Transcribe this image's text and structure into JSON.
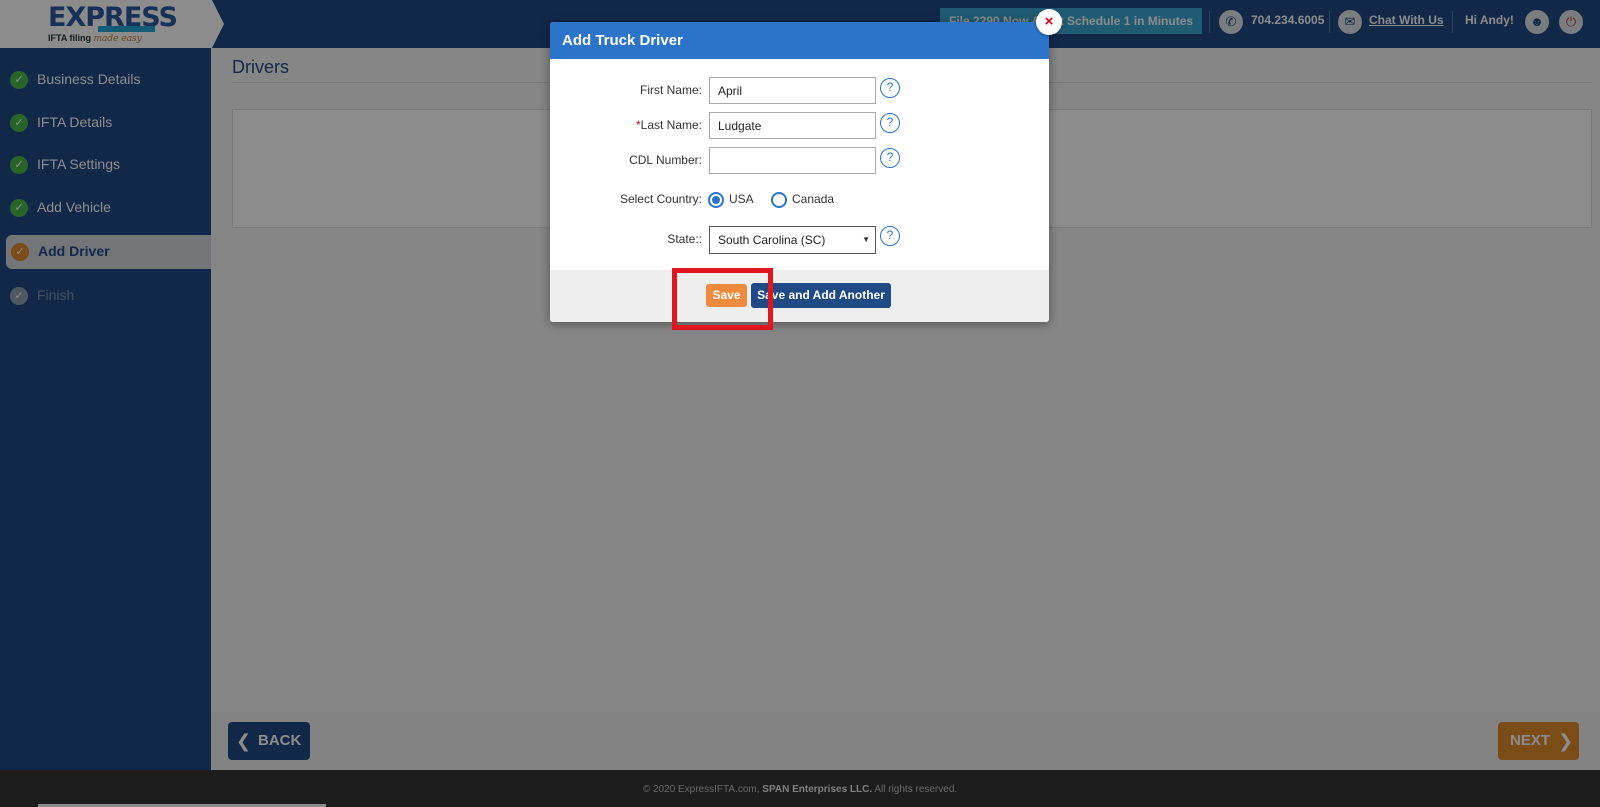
{
  "header": {
    "logo_text": "EXPRESS",
    "logo_badge": "IFTA",
    "logo_tagline": "IFTA filing",
    "logo_tagline_script": "made easy",
    "promo_text": "File 2290 Now & Get Schedule 1 in Minutes",
    "phone": "704.234.6005",
    "chat_label": "Chat With Us",
    "greeting": "Hi Andy!",
    "icons": {
      "phone": "phone-icon",
      "chat": "truck-chat-icon",
      "user": "user-icon",
      "power": "power-icon"
    }
  },
  "sidebar": {
    "items": [
      {
        "label": "Business Details",
        "state": "complete"
      },
      {
        "label": "IFTA Details",
        "state": "complete"
      },
      {
        "label": "IFTA Settings",
        "state": "complete"
      },
      {
        "label": "Add Vehicle",
        "state": "complete"
      },
      {
        "label": "Add Driver",
        "state": "active"
      },
      {
        "label": "Finish",
        "state": "disabled"
      }
    ]
  },
  "main": {
    "page_title": "Drivers",
    "back_label": "BACK",
    "next_label": "NEXT"
  },
  "modal": {
    "title": "Add Truck Driver",
    "close_glyph": "×",
    "fields": {
      "first_name": {
        "label": "First Name:",
        "value": "April"
      },
      "last_name": {
        "label": "Last Name:",
        "required_mark": "*",
        "value": "Ludgate"
      },
      "cdl_number": {
        "label": "CDL Number:",
        "value": ""
      },
      "country": {
        "label": "Select Country:",
        "options": [
          "USA",
          "Canada"
        ],
        "selected": "USA"
      },
      "state": {
        "label": "State::",
        "selected": "South Carolina (SC)"
      }
    },
    "help_glyph": "?",
    "save_label": "Save",
    "save_add_label": "Save and Add Another"
  },
  "footer": {
    "copyright": "© 2020 ExpressIFTA.com,",
    "company": "SPAN Enterprises LLC.",
    "rights": "All rights reserved."
  },
  "colors": {
    "brand_navy": "#1f4a85",
    "modal_header": "#2b74c9",
    "accent_orange": "#e08a2a",
    "save_orange": "#f08a3c",
    "check_green": "#4cb84c",
    "highlight_red": "#e0161f"
  }
}
